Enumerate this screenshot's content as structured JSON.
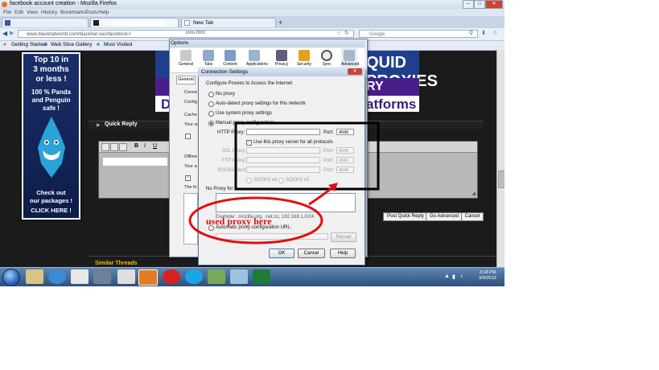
{
  "browser": {
    "window_title": "facebook account creation - Mozilla Firefox",
    "menu": [
      "File",
      "Edit",
      "View",
      "History",
      "Bookmarks",
      "Tools",
      "Help"
    ],
    "tabs": [
      "",
      "New Tab"
    ],
    "url": "www.blackhatworld.com/blackhat-seo/facebook-f",
    "url_right": "ions.html",
    "search_placeholder": "Google",
    "bookmarks": [
      "Getting Started",
      "Web Slice Gallery",
      "Most Visited"
    ]
  },
  "page": {
    "ad_lines": [
      "Top 10 in",
      "3 months",
      "or less !",
      "100 % Panda",
      "and Penguin",
      "safe !",
      "Check out",
      "our packages !",
      "CLICK HERE !"
    ],
    "banner_top": "QUID PROXIES",
    "banner_mid": "RY",
    "banner_bottom": "atforms",
    "banner_left": "D",
    "quick_reply_title": "Quick Reply",
    "buttons": [
      "Post Quick Reply",
      "Go Advanced",
      "Cancel"
    ],
    "similar_threads": "Similar Threads"
  },
  "options_dialog": {
    "title": "Options",
    "tabs": [
      "General",
      "Tabs",
      "Content",
      "Applications",
      "Privacy",
      "Security",
      "Sync",
      "Advanced"
    ],
    "subtab": "General",
    "side_labels": [
      "Conne",
      "Config",
      "Cache",
      "Your w",
      "Offline",
      "Your a",
      "The fo"
    ]
  },
  "connection_dialog": {
    "title": "Connection Settings",
    "heading": "Configure Proxies to Access the Internet",
    "options": [
      "No proxy",
      "Auto-detect proxy settings for this network",
      "Use system proxy settings",
      "Manual proxy configuration:"
    ],
    "selected_option": "Manual proxy configuration:",
    "http_label": "HTTP Proxy:",
    "port_label": "Port:",
    "http_port": "4040",
    "use_all_label": "Use this proxy server for all protocols",
    "use_all_checked": true,
    "ssl_label": "SSL Proxy:",
    "ftp_label": "FTP Proxy:",
    "socks_label": "SOCKS Host:",
    "disabled_port": "4040",
    "socks_v4": "SOCKS v4",
    "socks_v5": "SOCKS v5",
    "no_proxy_label": "No Proxy for:",
    "example": "Example: .mozilla.org, .net.nz, 192.168.1.0/24",
    "auto_url_label": "Automatic proxy configuration URL:",
    "reload": "Reload",
    "ok": "OK",
    "cancel": "Cancel",
    "help": "Help"
  },
  "annotation": {
    "text": "used proxy here",
    "color": "#e01010"
  },
  "taskbar": {
    "time": "3:18 PM",
    "date": "9/9/2013"
  }
}
